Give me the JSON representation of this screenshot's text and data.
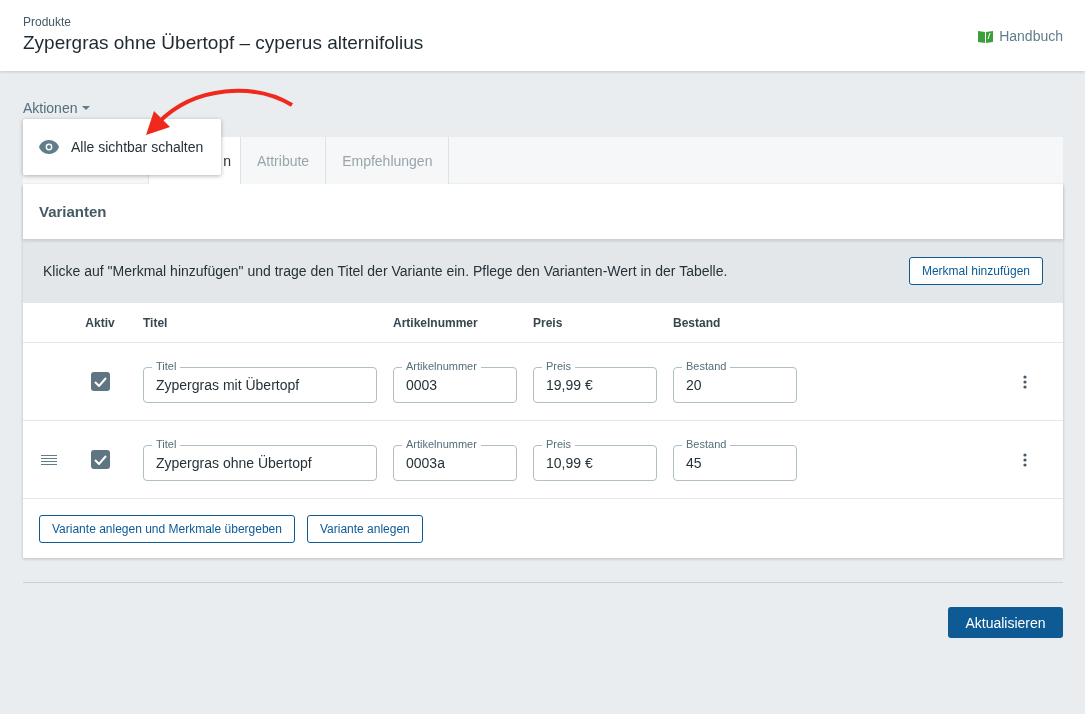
{
  "header": {
    "breadcrumb": "Produkte",
    "title": "Zypergras ohne Übertopf – cyperus alternifolius",
    "help_link": "Handbuch"
  },
  "actions": {
    "label": "Aktionen",
    "items": [
      "Alle sichtbar schalten"
    ]
  },
  "tabs": [
    {
      "label": "n",
      "selected": true
    },
    {
      "label": "Attribute",
      "selected": false
    },
    {
      "label": "Empfehlungen",
      "selected": false
    }
  ],
  "variants": {
    "title": "Varianten",
    "hint": "Klicke auf \"Merkmal hinzufügen\" und trage den Titel der Variante ein. Pflege den Varianten-Wert in der Tabelle.",
    "add_feature_button": "Merkmal hinzufügen",
    "columns": [
      "Aktiv",
      "Titel",
      "Artikelnummer",
      "Preis",
      "Bestand"
    ],
    "rows": [
      {
        "draggable": false,
        "checked": true,
        "fields": [
          {
            "label": "Titel",
            "value": "Zypergras mit Übertopf"
          },
          {
            "label": "Artikelnummer",
            "value": "0003"
          },
          {
            "label": "Preis",
            "value": "19,99 €"
          },
          {
            "label": "Bestand",
            "value": "20"
          }
        ]
      },
      {
        "draggable": true,
        "checked": true,
        "fields": [
          {
            "label": "Titel",
            "value": "Zypergras ohne Übertopf"
          },
          {
            "label": "Artikelnummer",
            "value": "0003a"
          },
          {
            "label": "Preis",
            "value": "10,99 €"
          },
          {
            "label": "Bestand",
            "value": "45"
          }
        ]
      }
    ],
    "buttons": [
      "Variante anlegen und Merkmale übergeben",
      "Variante anlegen"
    ]
  },
  "submit_button": "Aktualisieren"
}
